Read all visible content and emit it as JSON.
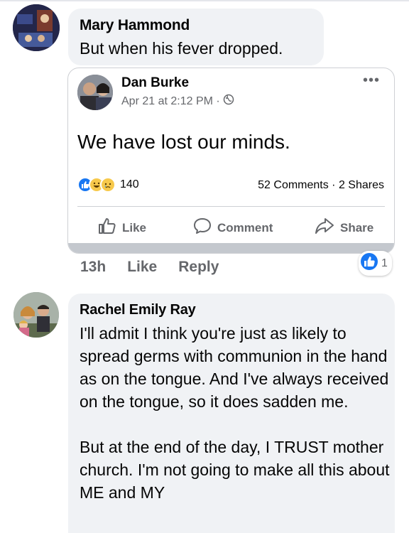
{
  "comment1": {
    "author": "Mary Hammond",
    "text": "But when his fever dropped.",
    "time": "13h",
    "like_label": "Like",
    "reply_label": "Reply",
    "like_count": "1",
    "shared_post": {
      "author": "Dan Burke",
      "meta": "Apr 21 at 2:12 PM ·",
      "more": "•••",
      "text": "We have lost our minds.",
      "reaction_count": "140",
      "counts": "52 Comments · 2 Shares",
      "actions": {
        "like": "Like",
        "comment": "Comment",
        "share": "Share"
      }
    }
  },
  "comment2": {
    "author": "Rachel Emily Ray",
    "text": "I'll admit I think you're just as likely to spread germs with communion in the hand as on the tongue.  And I've always received on the tongue, so it does sadden me.\n\nBut at the end of the day, I TRUST mother church.  I'm not going to make all this about ME and MY"
  },
  "colors": {
    "like_blue": "#1877f2",
    "muted": "#65676b",
    "bubble": "#f0f2f5"
  }
}
